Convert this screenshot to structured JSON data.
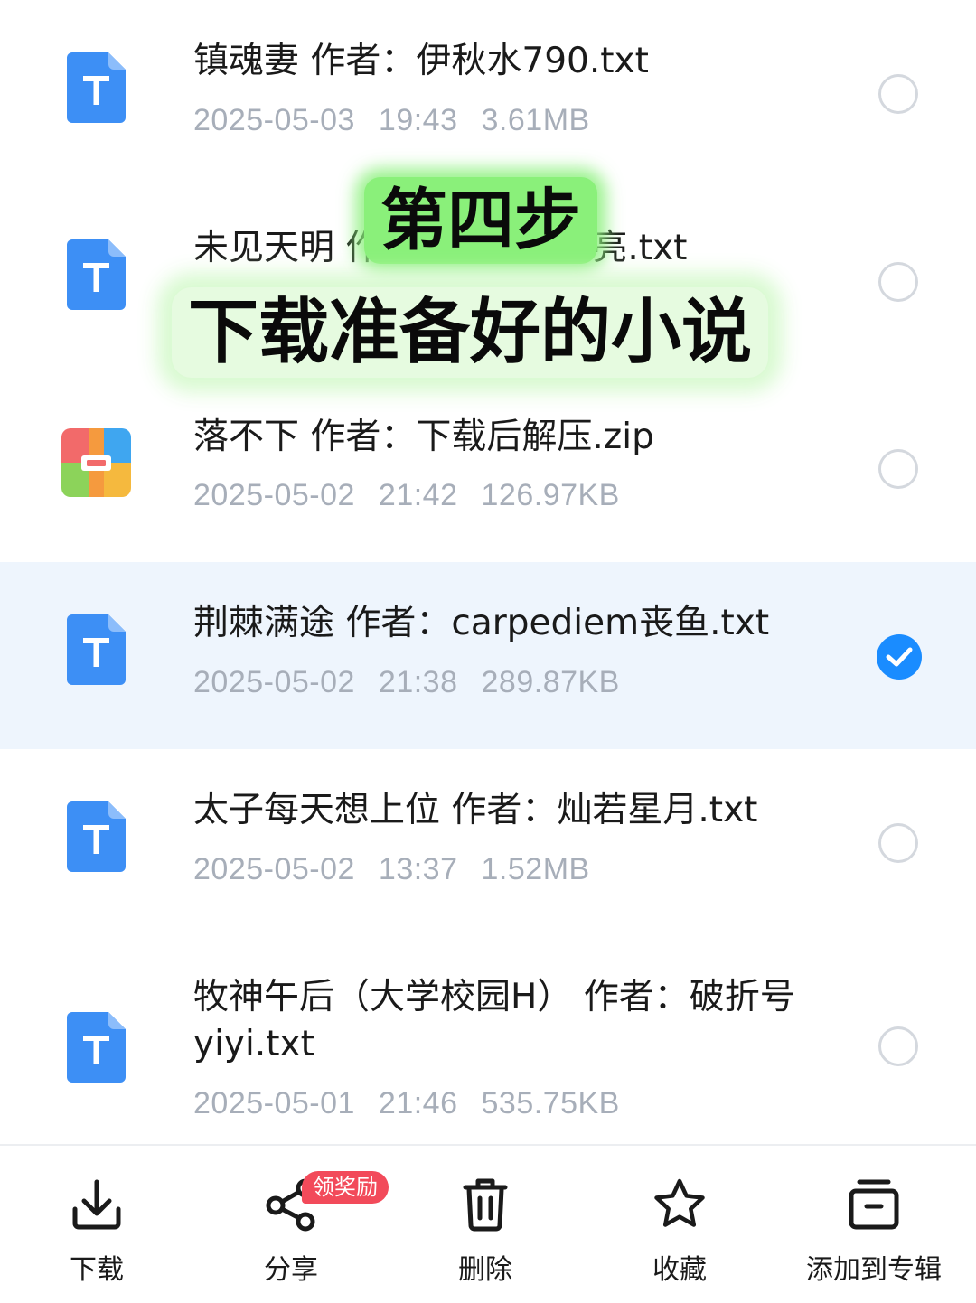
{
  "files": [
    {
      "name": "镇魂妻 作者：伊秋水790.txt",
      "date": "2025-05-03",
      "time": "19:43",
      "size": "3.61MB",
      "type": "txt-icon",
      "selected": false
    },
    {
      "name": "未见天明 作者：老婆最漂亮.txt",
      "date": "",
      "time": "",
      "size": "",
      "type": "txt-icon",
      "selected": false
    },
    {
      "name": "落不下 作者：下载后解压.zip",
      "date": "2025-05-02",
      "time": "21:42",
      "size": "126.97KB",
      "type": "zip-icon",
      "selected": false
    },
    {
      "name": "荆棘满途 作者：carpediem丧鱼.txt",
      "date": "2025-05-02",
      "time": "21:38",
      "size": "289.87KB",
      "type": "txt-icon",
      "selected": true
    },
    {
      "name": "太子每天想上位 作者：灿若星月.txt",
      "date": "2025-05-02",
      "time": "13:37",
      "size": "1.52MB",
      "type": "txt-icon",
      "selected": false
    },
    {
      "name": "牧神午后（大学校园H） 作者：破折号yiyi.txt",
      "date": "2025-05-01",
      "time": "21:46",
      "size": "535.75KB",
      "type": "txt-icon",
      "selected": false
    }
  ],
  "overlay": {
    "step": "第四步",
    "caption": "下载准备好的小说"
  },
  "bottom_bar": {
    "download": "下载",
    "share": "分享",
    "share_badge": "领奖励",
    "delete": "删除",
    "favorite": "收藏",
    "add_to_album": "添加到专辑"
  },
  "colors": {
    "accent": "#1a8cff",
    "selected_row_bg": "#eef5fd",
    "badge": "#f24a5a",
    "highlight_green": "#8af07a"
  }
}
